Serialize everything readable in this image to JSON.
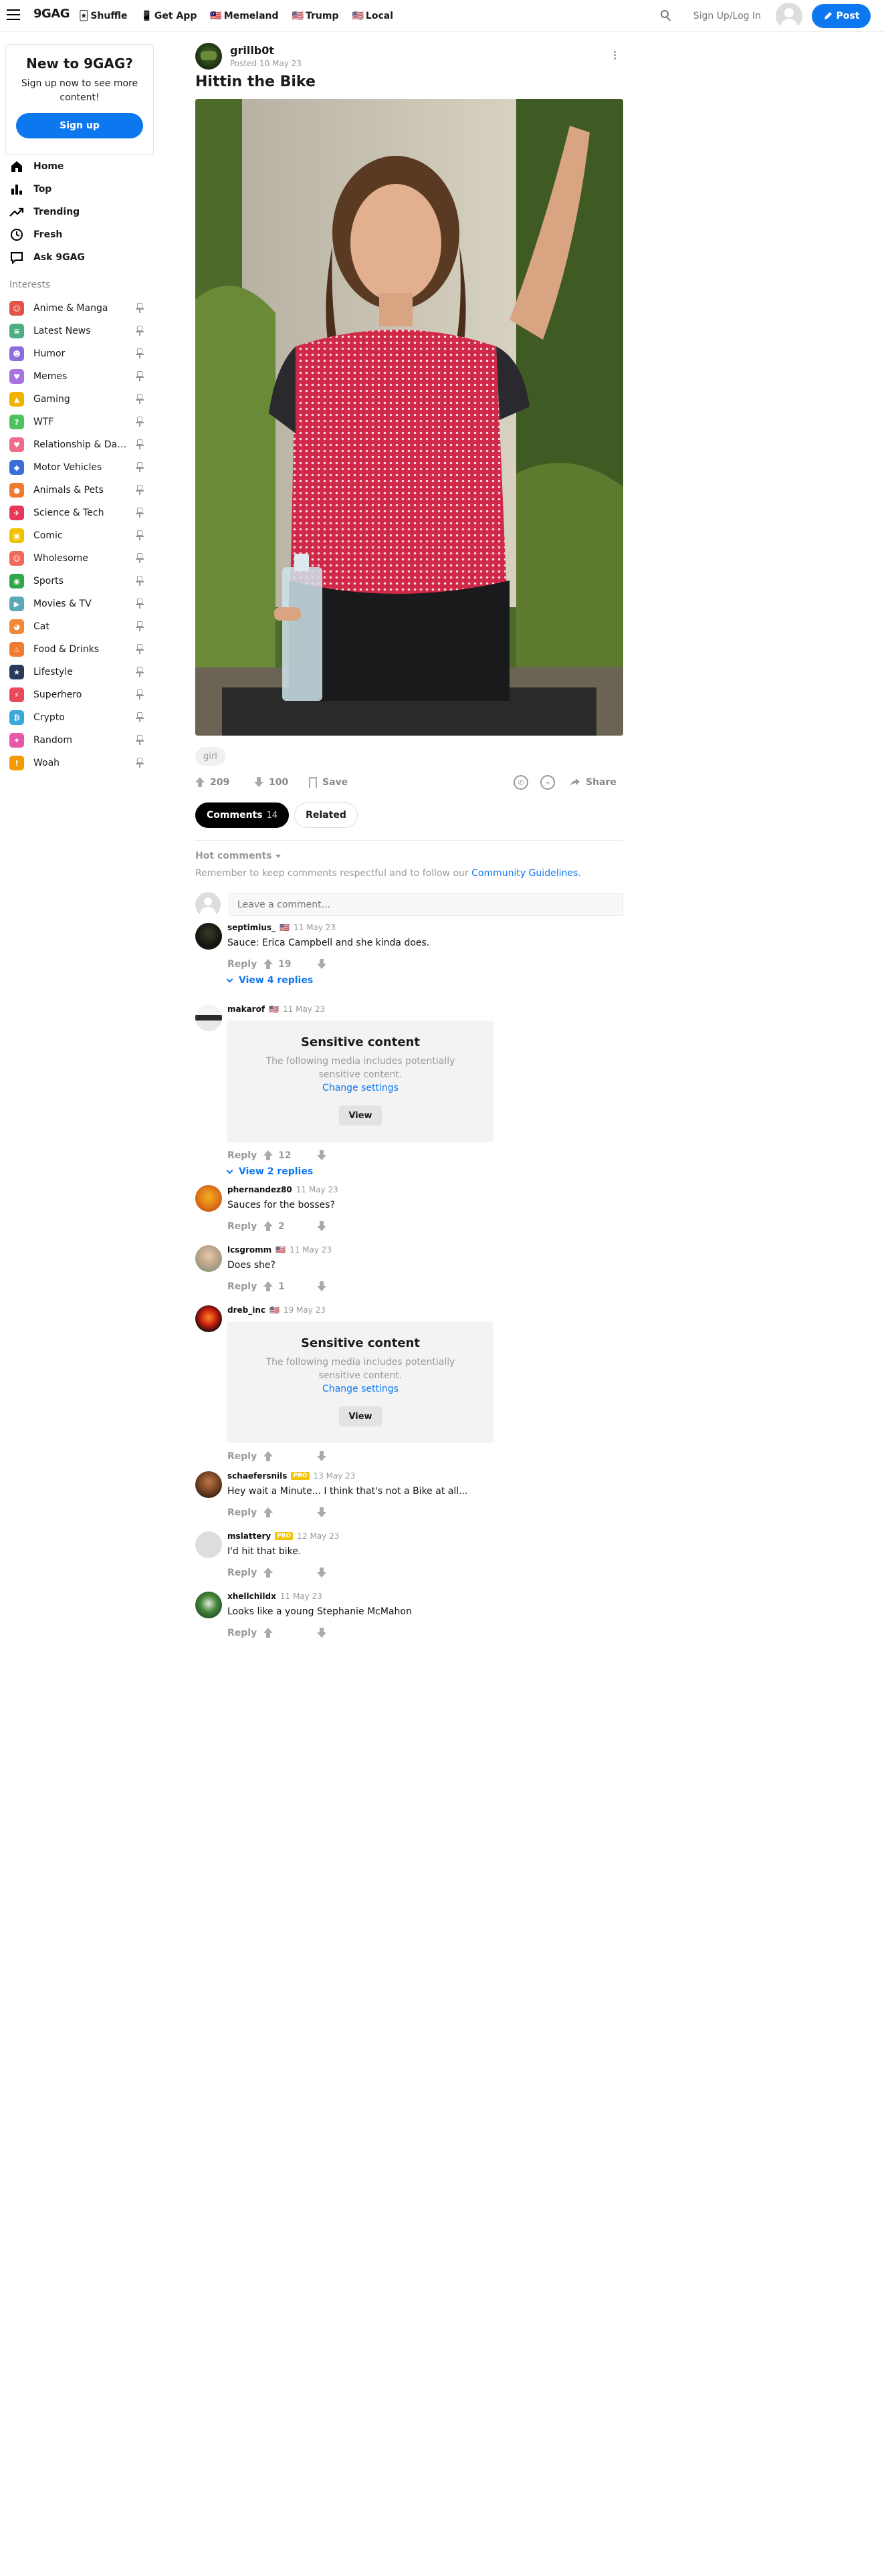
{
  "header": {
    "logo": "9GAG",
    "nav": [
      {
        "icon": "🃏",
        "label": "Shuffle"
      },
      {
        "icon": "📱",
        "label": "Get App"
      },
      {
        "icon": "🇲🇾",
        "label": "Memeland"
      },
      {
        "icon": "🇺🇸",
        "label": "Trump"
      },
      {
        "icon": "🇺🇸",
        "label": "Local"
      }
    ],
    "signup_login": "Sign Up/Log In",
    "post_label": "Post",
    "accent": "#0d77f0"
  },
  "sidebar": {
    "promo": {
      "title": "New to 9GAG?",
      "text": "Sign up now to see more content!",
      "button": "Sign up"
    },
    "main": [
      {
        "icon": "home-icon",
        "label": "Home"
      },
      {
        "icon": "bar-chart-icon",
        "label": "Top"
      },
      {
        "icon": "trending-icon",
        "label": "Trending"
      },
      {
        "icon": "clock-icon",
        "label": "Fresh"
      },
      {
        "icon": "chat-icon",
        "label": "Ask 9GAG"
      }
    ],
    "interests_title": "Interests",
    "interests": [
      {
        "label": "Anime & Manga",
        "color": "#e0524a",
        "glyph": "☺"
      },
      {
        "label": "Latest News",
        "color": "#4caf82",
        "glyph": "≡"
      },
      {
        "label": "Humor",
        "color": "#8e6cde",
        "glyph": "☻"
      },
      {
        "label": "Memes",
        "color": "#a872e0",
        "glyph": "♥"
      },
      {
        "label": "Gaming",
        "color": "#f2b200",
        "glyph": "▲"
      },
      {
        "label": "WTF",
        "color": "#4fc25f",
        "glyph": "?"
      },
      {
        "label": "Relationship & Dating",
        "color": "#f06a8a",
        "glyph": "♥"
      },
      {
        "label": "Motor Vehicles",
        "color": "#3a6fd8",
        "glyph": "◆"
      },
      {
        "label": "Animals & Pets",
        "color": "#f07a30",
        "glyph": "●"
      },
      {
        "label": "Science & Tech",
        "color": "#e8385a",
        "glyph": "✈"
      },
      {
        "label": "Comic",
        "color": "#f2c200",
        "glyph": "▣"
      },
      {
        "label": "Wholesome",
        "color": "#ef6a5a",
        "glyph": "☺"
      },
      {
        "label": "Sports",
        "color": "#2ea84a",
        "glyph": "◉"
      },
      {
        "label": "Movies & TV",
        "color": "#5aa8b8",
        "glyph": "▶"
      },
      {
        "label": "Cat",
        "color": "#f08a3a",
        "glyph": "◕"
      },
      {
        "label": "Food & Drinks",
        "color": "#ef7a30",
        "glyph": "♨"
      },
      {
        "label": "Lifestyle",
        "color": "#2a3a5a",
        "glyph": "★"
      },
      {
        "label": "Superhero",
        "color": "#e84a5a",
        "glyph": "⚡"
      },
      {
        "label": "Crypto",
        "color": "#3aa8d8",
        "glyph": "₿"
      },
      {
        "label": "Random",
        "color": "#e858a8",
        "glyph": "✦"
      },
      {
        "label": "Woah",
        "color": "#f29a00",
        "glyph": "!"
      }
    ]
  },
  "post": {
    "user": "grillb0t",
    "time": "Posted 10 May 23",
    "title": "Hittin the Bike",
    "tag": "girl",
    "upvotes": "209",
    "downvotes": "100",
    "save_label": "Save",
    "share_label": "Share"
  },
  "tabs": {
    "comments_label": "Comments",
    "comments_count": "14",
    "related_label": "Related"
  },
  "comments_section": {
    "sort_label": "Hot comments",
    "remember": "Remember to keep comments respectful and to follow our",
    "guidelines": "Community Guidelines.",
    "placeholder": "Leave a comment..."
  },
  "comments": [
    {
      "name": "septimius_",
      "flag": "🇺🇸",
      "time": "11 May 23",
      "text": "Sauce: Erica Campbell and she kinda does.",
      "votes": "19",
      "replies": "View 4 replies"
    },
    {
      "name": "makarof",
      "flag": "🇺🇸",
      "time": "11 May 23",
      "votes": "12",
      "replies": "View 2 replies"
    },
    {
      "name": "phernandez80",
      "time": "11 May 23",
      "text": "Sauces for the bosses?",
      "votes": "2"
    },
    {
      "name": "lcsgromm",
      "flag": "🇺🇸",
      "time": "11 May 23",
      "text": "Does she?",
      "votes": "1"
    },
    {
      "name": "dreb_inc",
      "flag": "🇺🇸",
      "time": "19 May 23"
    },
    {
      "name": "schaefersnils",
      "pro": "PRO",
      "time": "13 May 23",
      "text": "Hey wait a Minute... I think that's not a Bike at all..."
    },
    {
      "name": "mslattery",
      "pro": "PRO",
      "time": "12 May 23",
      "text": "I'd hit that bike."
    },
    {
      "name": "xhellchildx",
      "time": "11 May 23",
      "text": "Looks like a young Stephanie McMahon"
    }
  ],
  "sensitive": {
    "title": "Sensitive content",
    "text": "The following media includes potentially sensitive content.",
    "change": "Change settings",
    "view": "View"
  },
  "reply_label": "Reply"
}
